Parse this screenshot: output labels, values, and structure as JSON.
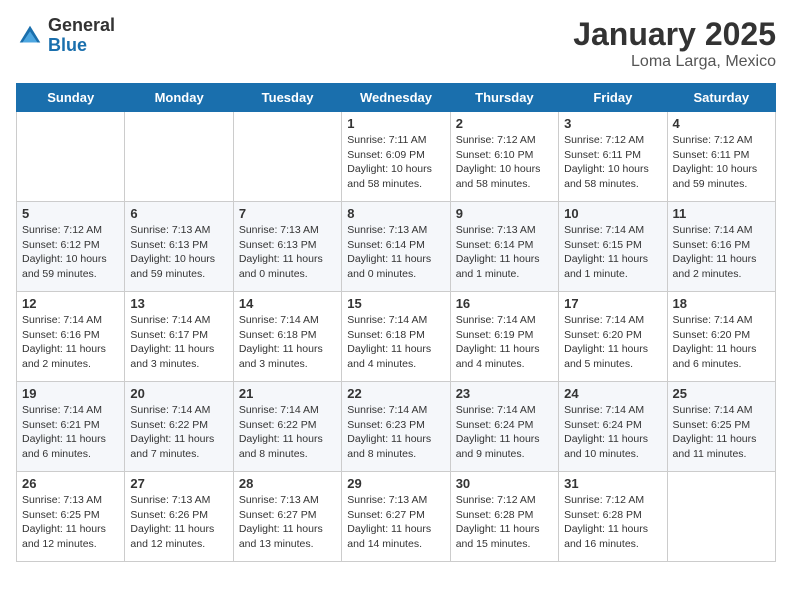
{
  "header": {
    "logo_general": "General",
    "logo_blue": "Blue",
    "month": "January 2025",
    "location": "Loma Larga, Mexico"
  },
  "weekdays": [
    "Sunday",
    "Monday",
    "Tuesday",
    "Wednesday",
    "Thursday",
    "Friday",
    "Saturday"
  ],
  "weeks": [
    [
      {
        "day": "",
        "info": ""
      },
      {
        "day": "",
        "info": ""
      },
      {
        "day": "",
        "info": ""
      },
      {
        "day": "1",
        "info": "Sunrise: 7:11 AM\nSunset: 6:09 PM\nDaylight: 10 hours and 58 minutes."
      },
      {
        "day": "2",
        "info": "Sunrise: 7:12 AM\nSunset: 6:10 PM\nDaylight: 10 hours and 58 minutes."
      },
      {
        "day": "3",
        "info": "Sunrise: 7:12 AM\nSunset: 6:11 PM\nDaylight: 10 hours and 58 minutes."
      },
      {
        "day": "4",
        "info": "Sunrise: 7:12 AM\nSunset: 6:11 PM\nDaylight: 10 hours and 59 minutes."
      }
    ],
    [
      {
        "day": "5",
        "info": "Sunrise: 7:12 AM\nSunset: 6:12 PM\nDaylight: 10 hours and 59 minutes."
      },
      {
        "day": "6",
        "info": "Sunrise: 7:13 AM\nSunset: 6:13 PM\nDaylight: 10 hours and 59 minutes."
      },
      {
        "day": "7",
        "info": "Sunrise: 7:13 AM\nSunset: 6:13 PM\nDaylight: 11 hours and 0 minutes."
      },
      {
        "day": "8",
        "info": "Sunrise: 7:13 AM\nSunset: 6:14 PM\nDaylight: 11 hours and 0 minutes."
      },
      {
        "day": "9",
        "info": "Sunrise: 7:13 AM\nSunset: 6:14 PM\nDaylight: 11 hours and 1 minute."
      },
      {
        "day": "10",
        "info": "Sunrise: 7:14 AM\nSunset: 6:15 PM\nDaylight: 11 hours and 1 minute."
      },
      {
        "day": "11",
        "info": "Sunrise: 7:14 AM\nSunset: 6:16 PM\nDaylight: 11 hours and 2 minutes."
      }
    ],
    [
      {
        "day": "12",
        "info": "Sunrise: 7:14 AM\nSunset: 6:16 PM\nDaylight: 11 hours and 2 minutes."
      },
      {
        "day": "13",
        "info": "Sunrise: 7:14 AM\nSunset: 6:17 PM\nDaylight: 11 hours and 3 minutes."
      },
      {
        "day": "14",
        "info": "Sunrise: 7:14 AM\nSunset: 6:18 PM\nDaylight: 11 hours and 3 minutes."
      },
      {
        "day": "15",
        "info": "Sunrise: 7:14 AM\nSunset: 6:18 PM\nDaylight: 11 hours and 4 minutes."
      },
      {
        "day": "16",
        "info": "Sunrise: 7:14 AM\nSunset: 6:19 PM\nDaylight: 11 hours and 4 minutes."
      },
      {
        "day": "17",
        "info": "Sunrise: 7:14 AM\nSunset: 6:20 PM\nDaylight: 11 hours and 5 minutes."
      },
      {
        "day": "18",
        "info": "Sunrise: 7:14 AM\nSunset: 6:20 PM\nDaylight: 11 hours and 6 minutes."
      }
    ],
    [
      {
        "day": "19",
        "info": "Sunrise: 7:14 AM\nSunset: 6:21 PM\nDaylight: 11 hours and 6 minutes."
      },
      {
        "day": "20",
        "info": "Sunrise: 7:14 AM\nSunset: 6:22 PM\nDaylight: 11 hours and 7 minutes."
      },
      {
        "day": "21",
        "info": "Sunrise: 7:14 AM\nSunset: 6:22 PM\nDaylight: 11 hours and 8 minutes."
      },
      {
        "day": "22",
        "info": "Sunrise: 7:14 AM\nSunset: 6:23 PM\nDaylight: 11 hours and 8 minutes."
      },
      {
        "day": "23",
        "info": "Sunrise: 7:14 AM\nSunset: 6:24 PM\nDaylight: 11 hours and 9 minutes."
      },
      {
        "day": "24",
        "info": "Sunrise: 7:14 AM\nSunset: 6:24 PM\nDaylight: 11 hours and 10 minutes."
      },
      {
        "day": "25",
        "info": "Sunrise: 7:14 AM\nSunset: 6:25 PM\nDaylight: 11 hours and 11 minutes."
      }
    ],
    [
      {
        "day": "26",
        "info": "Sunrise: 7:13 AM\nSunset: 6:25 PM\nDaylight: 11 hours and 12 minutes."
      },
      {
        "day": "27",
        "info": "Sunrise: 7:13 AM\nSunset: 6:26 PM\nDaylight: 11 hours and 12 minutes."
      },
      {
        "day": "28",
        "info": "Sunrise: 7:13 AM\nSunset: 6:27 PM\nDaylight: 11 hours and 13 minutes."
      },
      {
        "day": "29",
        "info": "Sunrise: 7:13 AM\nSunset: 6:27 PM\nDaylight: 11 hours and 14 minutes."
      },
      {
        "day": "30",
        "info": "Sunrise: 7:12 AM\nSunset: 6:28 PM\nDaylight: 11 hours and 15 minutes."
      },
      {
        "day": "31",
        "info": "Sunrise: 7:12 AM\nSunset: 6:28 PM\nDaylight: 11 hours and 16 minutes."
      },
      {
        "day": "",
        "info": ""
      }
    ]
  ]
}
